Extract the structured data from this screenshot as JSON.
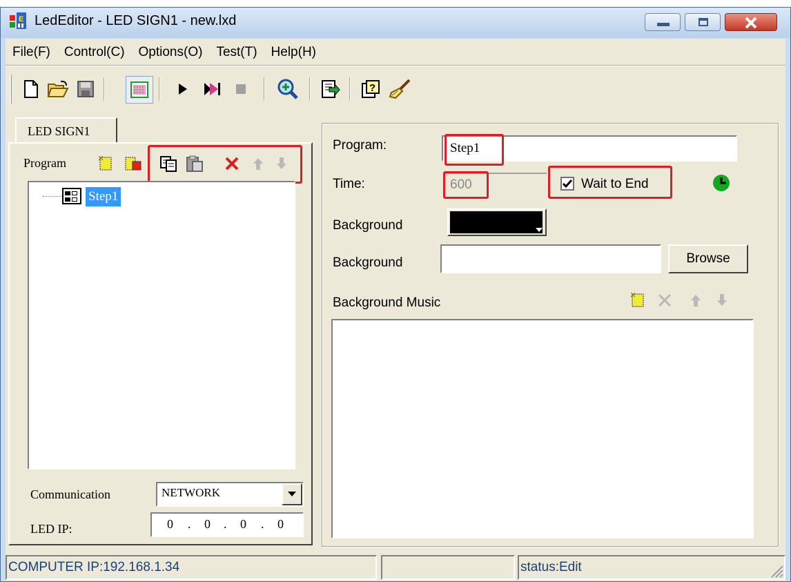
{
  "window": {
    "title": "LedEditor - LED SIGN1 - new.lxd",
    "app_icon_text": "E"
  },
  "menu": [
    "File(F)",
    "Control(C)",
    "Options(O)",
    "Test(T)",
    "Help(H)"
  ],
  "tab": {
    "label": "LED SIGN1"
  },
  "program_list": {
    "label": "Program",
    "items": [
      "Step1"
    ]
  },
  "communication": {
    "label": "Communication",
    "value": "NETWORK"
  },
  "led_ip": {
    "label": "LED IP:",
    "octets": [
      "0",
      "0",
      "0",
      "0"
    ]
  },
  "program_form": {
    "program_label": "Program:",
    "program_value": "Step1",
    "time_label": "Time:",
    "time_value": "600",
    "wait_label": "Wait to End",
    "wait_checked": true,
    "bg_color_label": "Background",
    "bg_color": "#000000",
    "bg_image_label": "Background",
    "bg_image_value": "",
    "browse_label": "Browse",
    "music_label": "Background Music"
  },
  "status": {
    "computer_ip": "COMPUTER IP:192.168.1.34",
    "middle": "",
    "state": "status:Edit"
  },
  "colors": {
    "annotation_red": "#e01c24",
    "selection": "#3399ff",
    "status_text": "#1a3f7a"
  }
}
